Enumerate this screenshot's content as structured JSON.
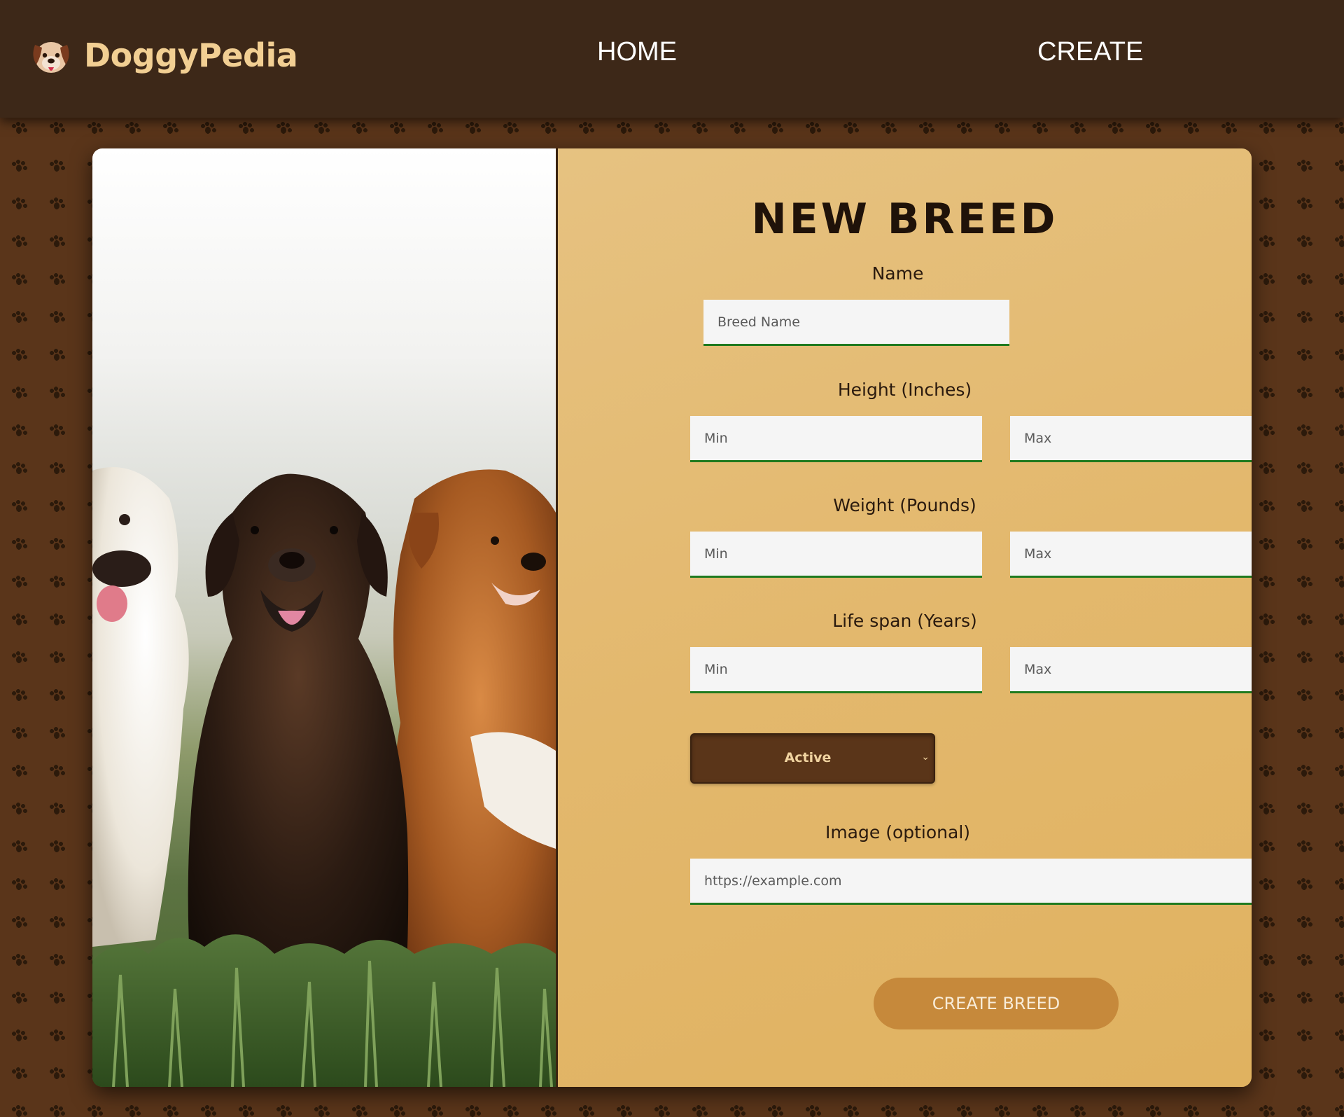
{
  "header": {
    "brand_name": "DoggyPedia",
    "logo_icon": "dog-face-icon",
    "nav": {
      "home": "HOME",
      "create": "CREATE"
    }
  },
  "hero": {
    "image": "three-dogs-photo"
  },
  "form": {
    "title": "NEW BREED",
    "name_label": "Name",
    "name_placeholder": "Breed Name",
    "height_label": "Height (Inches)",
    "weight_label": "Weight (Pounds)",
    "lifespan_label": "Life span (Years)",
    "min_placeholder": "Min",
    "max_placeholder": "Max",
    "temperament_selected": "Active",
    "image_label": "Image (optional)",
    "image_placeholder": "https://example.com",
    "submit_label": "CREATE BREED"
  },
  "colors": {
    "header_bg": "#3d2818",
    "brand": "#f2cf93",
    "page_bg": "#5a351a",
    "panel": "#e3b86d",
    "input_underline": "#1f7a1f",
    "select_bg": "#5a3519",
    "button": "#c6893b"
  }
}
